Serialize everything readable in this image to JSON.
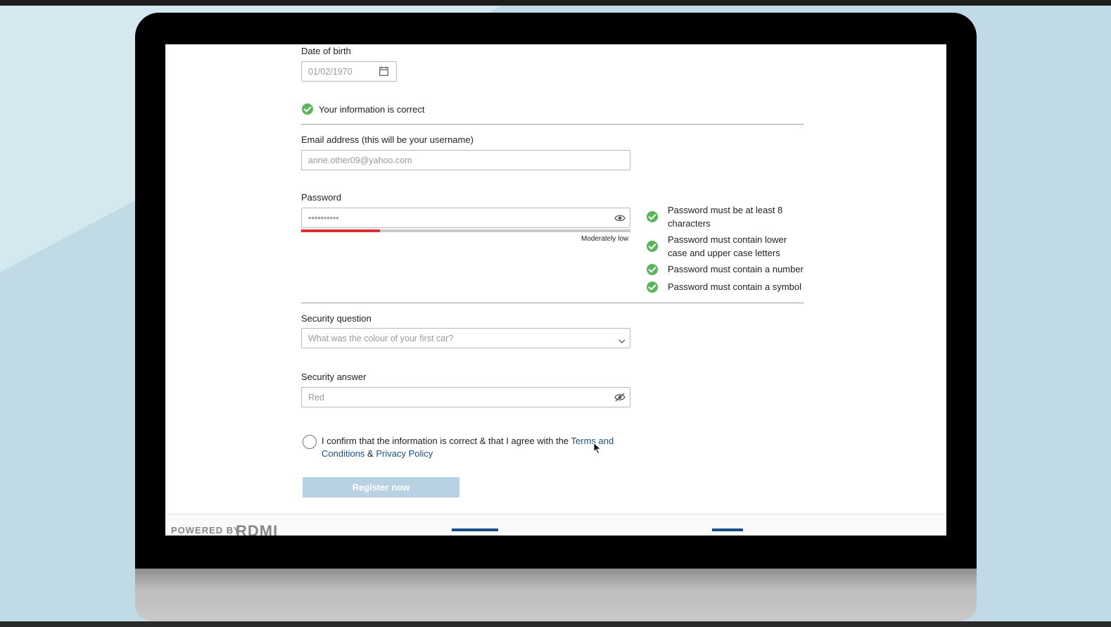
{
  "form": {
    "dob": {
      "label": "Date of birth",
      "value": "01/02/1970",
      "icon": "calendar-icon"
    },
    "info_status": {
      "text": "Your information is correct",
      "icon": "check-circle-icon"
    },
    "email": {
      "label": "Email address (this will be your username)",
      "value": "anne.other09@yahoo.com"
    },
    "password": {
      "label": "Password",
      "value": "••••••••••",
      "icon": "eye-icon",
      "strength_text": "Moderately low",
      "strength_fraction": 0.24,
      "strength_color": "#d83135"
    },
    "password_rules": [
      {
        "text": "Password must be at least 8 characters",
        "met": true
      },
      {
        "text": "Password must  contain lower case and upper case letters",
        "met": true
      },
      {
        "text": "Password must  contain a number",
        "met": true
      },
      {
        "text": "Password must  contain a symbol",
        "met": true
      }
    ],
    "security_question": {
      "label": "Security question",
      "value": "What was the colour of your first car?",
      "icon": "chevron-down-icon"
    },
    "security_answer": {
      "label": "Security answer",
      "value": "Red",
      "icon": "eye-off-icon"
    },
    "consent": {
      "text_before": "I confirm that the information is correct & that I agree with the ",
      "terms_link": "Terms and Conditions",
      "text_between": " & ",
      "privacy_link": "Privacy Policy"
    },
    "register_button": "Register now"
  },
  "colors": {
    "accent": "#1b4f8a",
    "success": "#5ab55b",
    "button_disabled": "#b8d1e3"
  },
  "footer": {
    "logo_prefix": "POWERED BY",
    "logo_text": "RDMI"
  }
}
